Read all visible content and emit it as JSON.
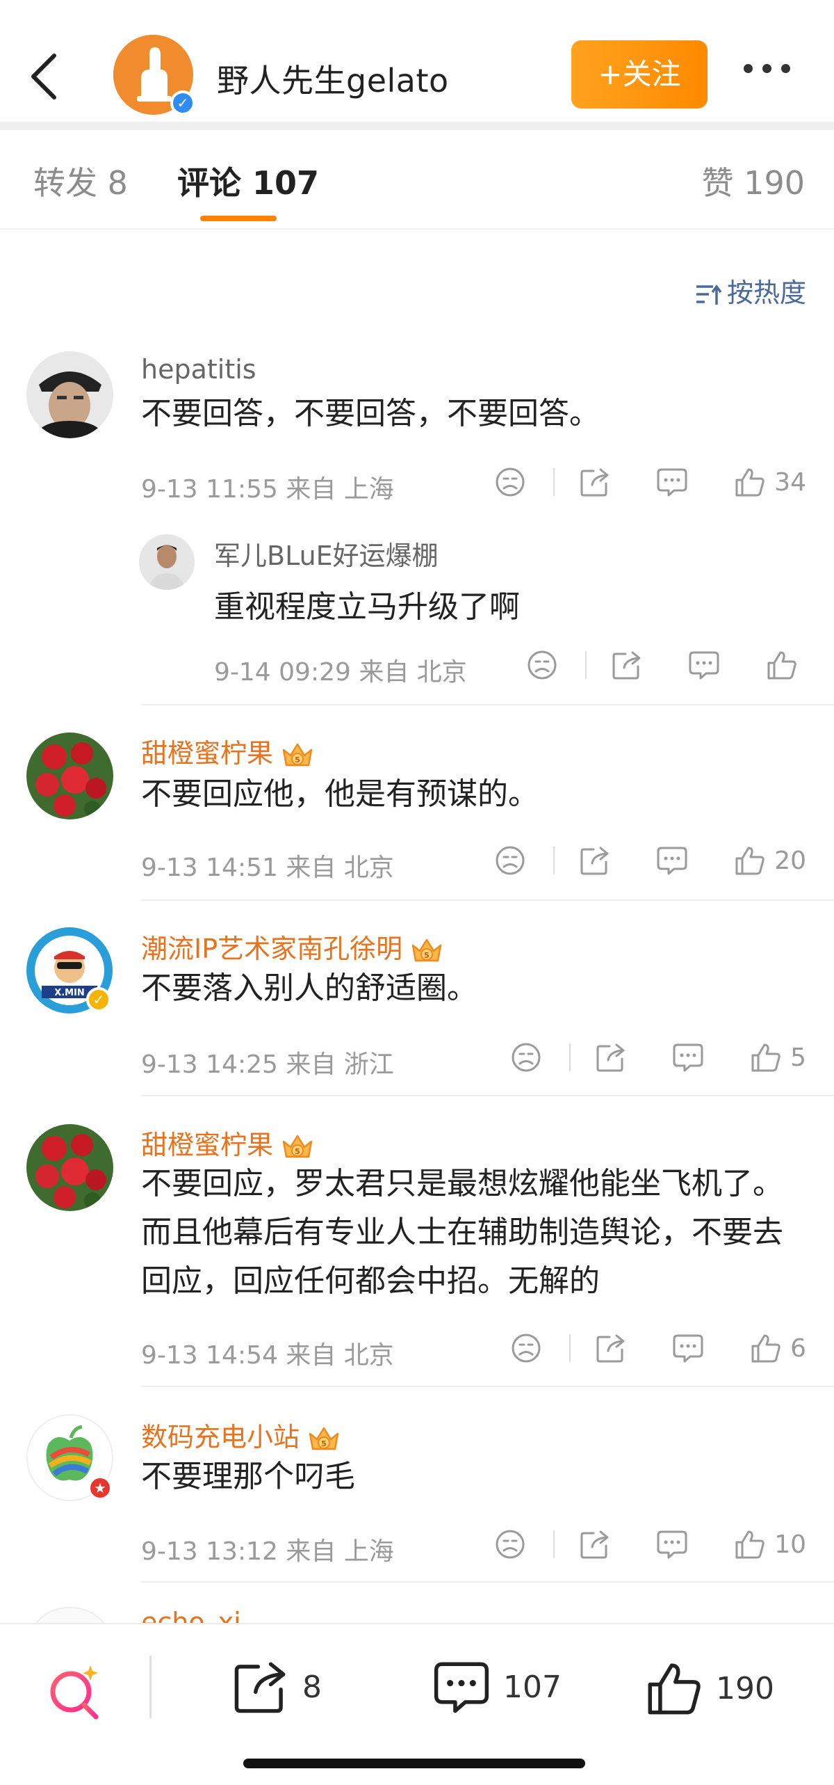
{
  "header": {
    "back_icon": "chevron-left-icon",
    "author_name": "野人先生gelato",
    "follow_label": "+关注",
    "more_icon": "more-dots-icon",
    "brand_color": "#ff8200"
  },
  "tabs": [
    {
      "label": "转发 8",
      "active": false
    },
    {
      "label": "评论 107",
      "active": true
    },
    {
      "label": "赞 190",
      "active": false
    }
  ],
  "sort": {
    "label": "按热度",
    "icon": "sort-icon"
  },
  "comments": [
    {
      "name": "hepatitis",
      "vip": false,
      "text": "不要回答，不要回答，不要回答。",
      "time": "9-13 11:55 来自 上海",
      "likes": "34",
      "reply": {
        "name": "军儿BLuE好运爆棚",
        "text": "重视程度立马升级了啊",
        "time": "9-14 09:29 来自 北京",
        "likes": ""
      }
    },
    {
      "name": "甜橙蜜柠果",
      "vip": true,
      "text": "不要回应他，他是有预谋的。",
      "time": "9-13 14:51 来自 北京",
      "likes": "20"
    },
    {
      "name": "潮流IP艺术家南孔徐明",
      "vip": true,
      "text": "不要落入别人的舒适圈。",
      "time": "9-13 14:25 来自 浙江",
      "likes": "5"
    },
    {
      "name": "甜橙蜜柠果",
      "vip": true,
      "text": "不要回应，罗太君只是最想炫耀他能坐飞机了。而且他幕后有专业人士在辅助制造舆论，不要去回应，回应任何都会中招。无解的",
      "time": "9-13 14:54 来自 北京",
      "likes": "6"
    },
    {
      "name": "数码充电小站",
      "vip": true,
      "text": "不要理那个叼毛",
      "time": "9-13 13:12 来自 上海",
      "likes": "10"
    }
  ],
  "partial_comment_name": "echo_xi",
  "bottom_bar": {
    "search_icon": "super-search-icon",
    "repost_count": "8",
    "comment_count": "107",
    "like_count": "190"
  }
}
